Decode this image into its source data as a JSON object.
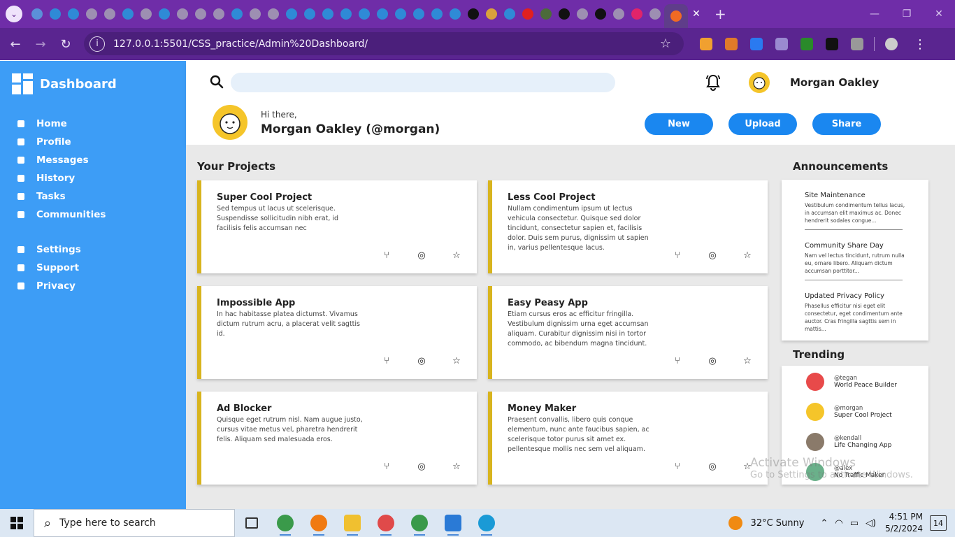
{
  "browser": {
    "address_url": "127.0.0.1:5501/CSS_practice/Admin%20Dashboard/",
    "tab_favicon_colors": [
      "#5b8fd9",
      "#2f8ad6",
      "#2f8ad6",
      "#9d8fb2",
      "#9d8fb2",
      "#2f8ad6",
      "#9d8fb2",
      "#2f8ad6",
      "#9d8fb2",
      "#9d8fb2",
      "#9d8fb2",
      "#2f8ad6",
      "#9d8fb2",
      "#9d8fb2",
      "#2f8ad6",
      "#2f8ad6",
      "#2f8ad6",
      "#2f8ad6",
      "#2f8ad6",
      "#2f8ad6",
      "#2f8ad6",
      "#2f8ad6",
      "#2f8ad6",
      "#2f8ad6",
      "#111111",
      "#d9a23c",
      "#2f8ad6",
      "#e02020",
      "#4c6b3a",
      "#111111",
      "#9d8fb2",
      "#111111",
      "#9d8fb2",
      "#e0246a",
      "#9d8fb2",
      "#f06a24"
    ],
    "extension_colors": [
      "#f0a030",
      "#e07a2a",
      "#2a7af0",
      "#9a8ad0",
      "#2a8a2a",
      "#111111",
      "#999999",
      "#cccccc"
    ]
  },
  "sidebar": {
    "brand": "Dashboard",
    "primary_items": [
      {
        "label": "Home",
        "icon": "home-icon"
      },
      {
        "label": "Profile",
        "icon": "profile-icon"
      },
      {
        "label": "Messages",
        "icon": "messages-icon"
      },
      {
        "label": "History",
        "icon": "history-icon"
      },
      {
        "label": "Tasks",
        "icon": "tasks-icon"
      },
      {
        "label": "Communities",
        "icon": "communities-icon"
      }
    ],
    "secondary_items": [
      {
        "label": "Settings",
        "icon": "settings-icon"
      },
      {
        "label": "Support",
        "icon": "support-icon"
      },
      {
        "label": "Privacy",
        "icon": "privacy-icon"
      }
    ]
  },
  "header": {
    "search_placeholder": "",
    "user_name": "Morgan Oakley",
    "greeting": "Hi there,",
    "profile_name": "Morgan Oakley (@morgan)",
    "buttons": {
      "new": "New",
      "upload": "Upload",
      "share": "Share"
    }
  },
  "projects": {
    "title": "Your Projects",
    "items": [
      {
        "title": "Super Cool Project",
        "desc": "Sed tempus ut lacus ut scelerisque. Suspendisse sollicitudin nibh erat, id facilisis felis accumsan nec"
      },
      {
        "title": "Less Cool Project",
        "desc": "Nullam condimentum ipsum ut lectus vehicula consectetur. Quisque sed dolor tincidunt, consectetur sapien et, facilisis dolor. Duis sem purus, dignissim ut sapien in, varius pellentesque lacus."
      },
      {
        "title": "Impossible App",
        "desc": "In hac habitasse platea dictumst. Vivamus dictum rutrum acru, a placerat velit sagttis id."
      },
      {
        "title": "Easy Peasy App",
        "desc": "Etiam cursus eros ac efficitur fringilla. Vestibulum dignissim urna eget accumsan aliquam. Curabitur dignissim nisi in tortor commodo, ac bibendum magna tincidunt."
      },
      {
        "title": "Ad Blocker",
        "desc": "Quisque eget rutrum nisl. Nam augue justo, cursus vitae metus vel, pharetra hendrerit felis. Aliquam sed malesuada eros."
      },
      {
        "title": "Money Maker",
        "desc": "Praesent convallis, libero quis conque elementum, nunc ante faucibus sapien, ac scelerisque totor purus sit amet ex. pellentesque mollis nec sem vel aliquam."
      }
    ]
  },
  "announcements": {
    "title": "Announcements",
    "items": [
      {
        "title": "Site Maintenance",
        "desc": "Vestibulum condimentum tellus lacus, in accumsan elit maximus ac. Donec hendrerit sodales congue..."
      },
      {
        "title": "Community Share Day",
        "desc": "Nam vel lectus tincidunt, rutrum nulla eu, ornare libero. Aliquam dictum accumsan porttitor..."
      },
      {
        "title": "Updated Privacy Policy",
        "desc": "Phasellus efficitur nisi eget elit consectetur, eget condimentum ante auctor. Cras fringilla sagttis sem in mattis..."
      }
    ]
  },
  "trending": {
    "title": "Trending",
    "items": [
      {
        "handle": "@tegan",
        "project": "World Peace Builder",
        "avatar_color": "#e84a4a"
      },
      {
        "handle": "@morgan",
        "project": "Super Cool Project",
        "avatar_color": "#f5c52a"
      },
      {
        "handle": "@kendall",
        "project": "Life Changing App",
        "avatar_color": "#8a7a6a"
      },
      {
        "handle": "@alex",
        "project": "No Traffic Maker",
        "avatar_color": "#6ab08a"
      }
    ]
  },
  "watermark": {
    "line1": "Activate Windows",
    "line2": "Go to Settings to activate Windows."
  },
  "taskbar": {
    "search_placeholder": "Type here to search",
    "apps": [
      {
        "name": "task-view-icon",
        "color": "#333333"
      },
      {
        "name": "chrome-icon",
        "color": "#3a9a4a"
      },
      {
        "name": "vlc-icon",
        "color": "#f07a12"
      },
      {
        "name": "file-explorer-icon",
        "color": "#f0c030"
      },
      {
        "name": "snipping-tool-icon",
        "color": "#e04a4a"
      },
      {
        "name": "chrome-profile-icon",
        "color": "#3a9a4a"
      },
      {
        "name": "vscode-icon",
        "color": "#2a7ad6"
      },
      {
        "name": "edge-icon",
        "color": "#1a9ad6"
      }
    ],
    "weather": "32°C  Sunny",
    "time": "4:51 PM",
    "date": "5/2/2024",
    "notifications": "14"
  }
}
